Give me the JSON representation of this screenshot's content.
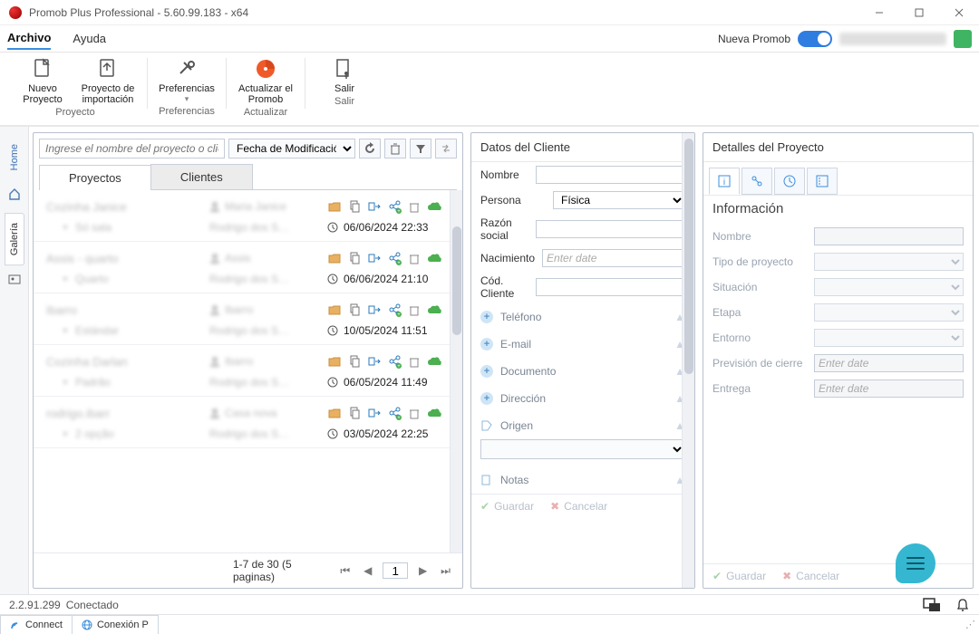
{
  "window": {
    "title": "Promob Plus Professional - 5.60.99.183 - x64"
  },
  "menu": {
    "file": "Archivo",
    "help": "Ayuda",
    "brand": "Nueva Promob"
  },
  "ribbon": {
    "groups": [
      {
        "label": "Proyecto",
        "buttons": [
          {
            "label": "Nuevo Proyecto",
            "icon": "file-new"
          },
          {
            "label": "Proyecto de importación",
            "icon": "file-import"
          }
        ]
      },
      {
        "label": "Preferencias",
        "buttons": [
          {
            "label": "Preferencias",
            "icon": "gear-cross"
          }
        ]
      },
      {
        "label": "Actualizar",
        "buttons": [
          {
            "label": "Actualizar el Promob",
            "icon": "globe-orange"
          }
        ]
      },
      {
        "label": "Salir",
        "buttons": [
          {
            "label": "Salir",
            "icon": "exit-door"
          }
        ]
      }
    ]
  },
  "rail": {
    "home": "Home",
    "galeria": "Galería"
  },
  "panel1": {
    "search_placeholder": "Ingrese el nombre del proyecto o cliente",
    "sort_label": "Fecha de Modificación",
    "tabs": {
      "projects": "Proyectos",
      "clients": "Clientes"
    },
    "rows": [
      {
        "name": "Cozinha Janice",
        "owner": "Maria Janice",
        "sub": "Só sala",
        "by": "Rodrigo dos S…",
        "date": "06/06/2024 22:33"
      },
      {
        "name": "Assis - quarto",
        "owner": "Assis",
        "sub": "Quarto",
        "by": "Rodrigo dos S…",
        "date": "06/06/2024 21:10"
      },
      {
        "name": "Ibarro",
        "owner": "Ibarro",
        "sub": "Estándar",
        "by": "Rodrigo dos S…",
        "date": "10/05/2024 11:51"
      },
      {
        "name": "Cozinha Darlan",
        "owner": "Ibarro",
        "sub": "Padrão",
        "by": "Rodrigo dos S…",
        "date": "06/05/2024 11:49"
      },
      {
        "name": "rodrigo.ibarr",
        "owner": "Casa nova",
        "sub": "2 opção",
        "by": "Rodrigo dos S…",
        "date": "03/05/2024 22:25"
      }
    ],
    "pager": {
      "text": "1-7 de 30 (5 paginas)",
      "page": "1"
    }
  },
  "panel2": {
    "title": "Datos del Cliente",
    "fields": {
      "nombre": "Nombre",
      "persona": "Persona",
      "persona_val": "Física",
      "razon": "Razón social",
      "nacimiento": "Nacimiento",
      "nac_ph": "Enter date",
      "codcliente": "Cód. Cliente"
    },
    "sections": {
      "telefono": "Teléfono",
      "email": "E-mail",
      "documento": "Documento",
      "direccion": "Dirección",
      "origen": "Origen",
      "notas": "Notas"
    },
    "actions": {
      "save": "Guardar",
      "cancel": "Cancelar"
    }
  },
  "panel3": {
    "title": "Detalles del Proyecto",
    "section": "Información",
    "fields": {
      "nombre": "Nombre",
      "tipo": "Tipo de proyecto",
      "situacion": "Situación",
      "etapa": "Etapa",
      "entorno": "Entorno",
      "prevision": "Previsión de cierre",
      "entrega": "Entrega",
      "date_ph": "Enter date"
    },
    "actions": {
      "save": "Guardar",
      "cancel": "Cancelar"
    }
  },
  "status": {
    "ver": "2.2.91.299",
    "conn": "Conectado",
    "connect": "Connect",
    "conexion": "Conexión P"
  }
}
